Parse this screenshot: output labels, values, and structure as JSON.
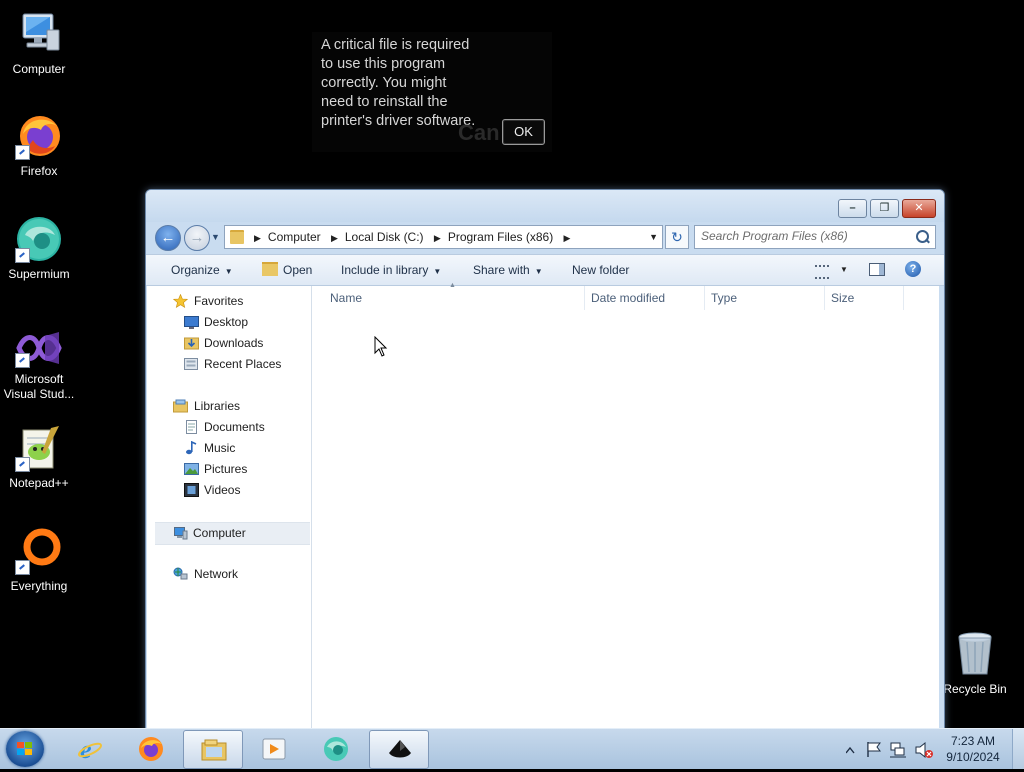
{
  "desktop": {
    "icons": [
      {
        "label": "Computer",
        "icon": "computer-icon"
      },
      {
        "label": "Firefox",
        "icon": "firefox-icon"
      },
      {
        "label": "Supermium",
        "icon": "supermium-icon"
      },
      {
        "label_line1": "Microsoft",
        "label_line2": "Visual Stud...",
        "icon": "visual-studio-icon"
      },
      {
        "label": "Notepad++",
        "icon": "notepad-plus-plus-icon"
      },
      {
        "label": "Everything",
        "icon": "everything-icon"
      }
    ],
    "recycle_bin": "Recycle Bin"
  },
  "dialog": {
    "message": "A critical file is required to use this program correctly. You might need to reinstall the printer's driver software.",
    "ghost_text": "Can",
    "ok_label": "OK"
  },
  "explorer": {
    "address": {
      "crumbs": [
        "Computer",
        "Local Disk (C:)",
        "Program Files (x86)"
      ]
    },
    "search": {
      "placeholder": "Search Program Files (x86)"
    },
    "toolbar": {
      "organize": "Organize",
      "open": "Open",
      "include_in_library": "Include in library",
      "share_with": "Share with",
      "new_folder": "New folder"
    },
    "nav": {
      "favorites": "Favorites",
      "desktop": "Desktop",
      "downloads": "Downloads",
      "recent_places": "Recent Places",
      "libraries": "Libraries",
      "documents": "Documents",
      "music": "Music",
      "pictures": "Pictures",
      "videos": "Videos",
      "computer": "Computer",
      "network": "Network"
    },
    "columns": {
      "name": "Name",
      "date_modified": "Date modified",
      "type": "Type",
      "size": "Size"
    }
  },
  "taskbar": {
    "apps": [
      "internet-explorer-icon",
      "firefox-icon",
      "windows-explorer-icon",
      "media-player-icon",
      "supermium-icon",
      "unknown-app-icon"
    ],
    "clock": {
      "time": "7:23 AM",
      "date": "9/10/2024"
    }
  }
}
